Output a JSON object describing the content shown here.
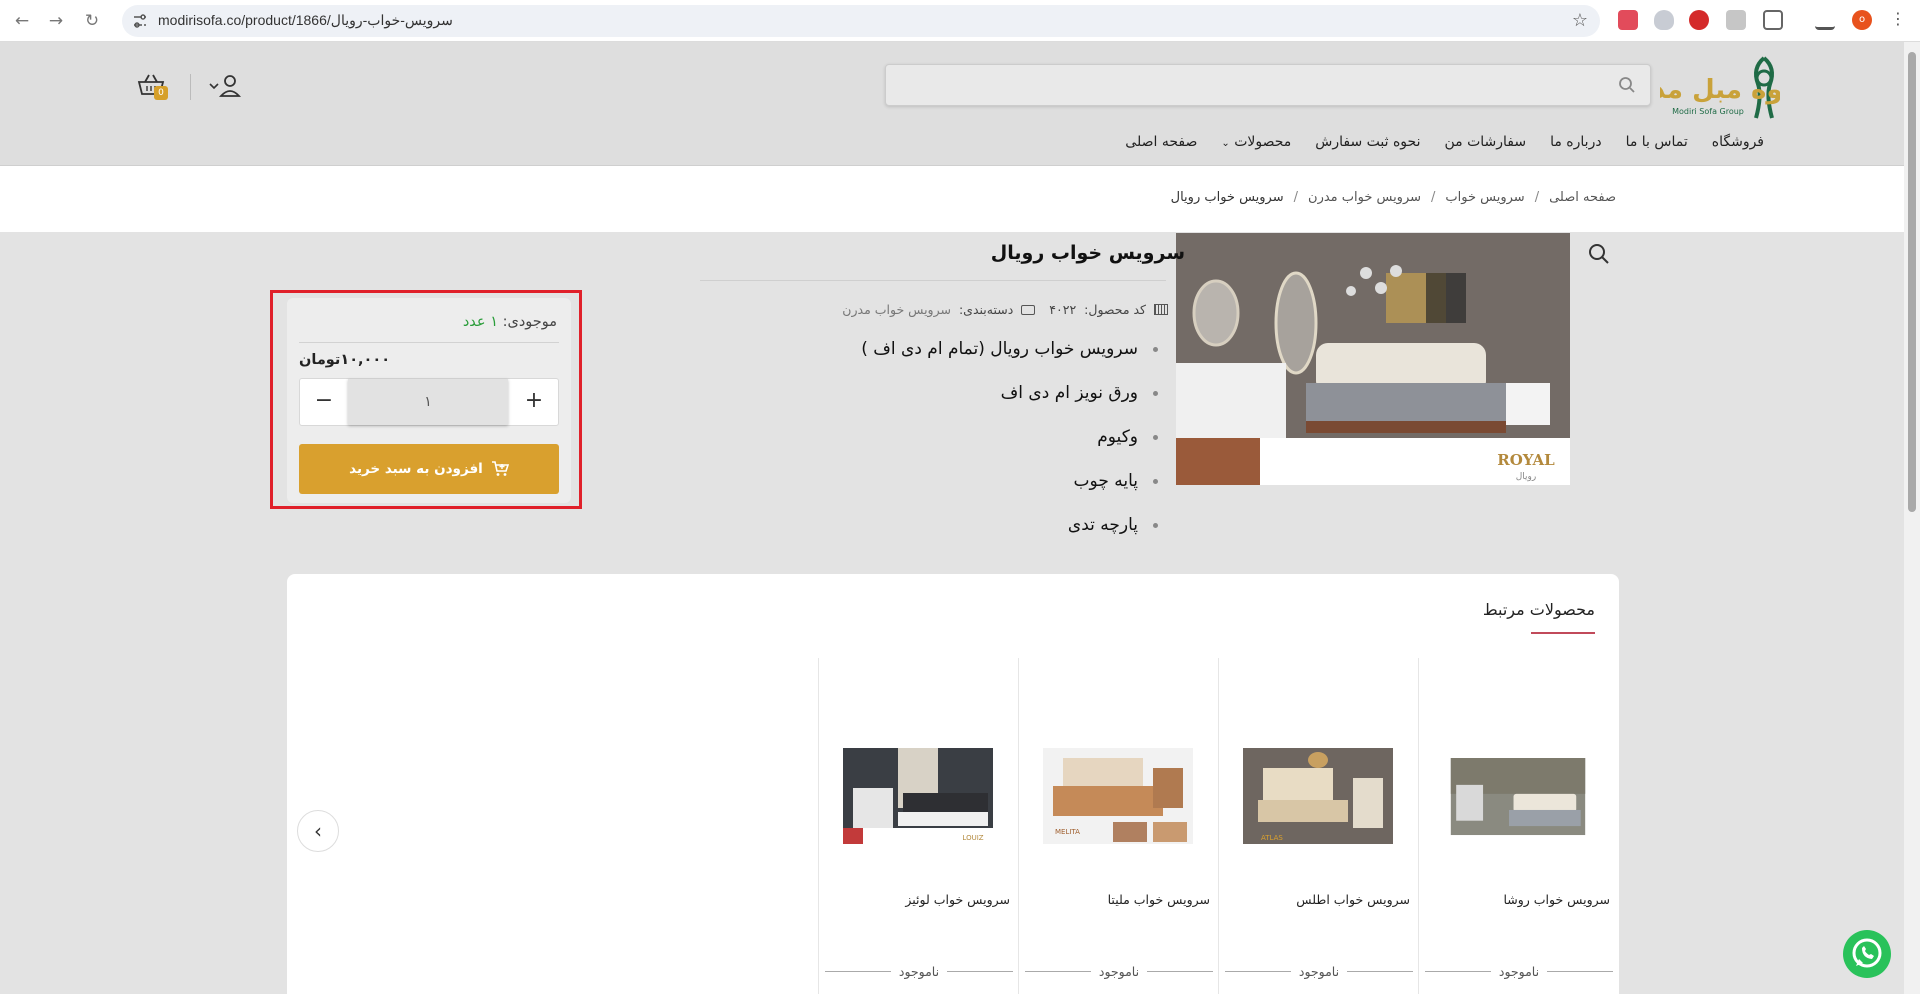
{
  "browser": {
    "url": "modirisofa.co/product/1866/سرویس-خواب-رویال",
    "profile_initial": "o"
  },
  "header": {
    "logo_text_fa": "گروه مبل مدیری",
    "logo_text_en": "Modiri Sofa Group",
    "search_placeholder": "",
    "cart_count": "0",
    "nav": [
      "صفحه اصلی",
      "محصولات",
      "نحوه ثبت سفارش",
      "سفارشات من",
      "درباره ما",
      "تماس با ما",
      "فروشگاه"
    ]
  },
  "breadcrumb": {
    "items": [
      "صفحه اصلی",
      "سرویس خواب",
      "سرویس خواب مدرن",
      "سرویس خواب رویال"
    ],
    "separator": "/"
  },
  "product": {
    "title": "سرویس خواب رویال",
    "code_label": "کد محصول:",
    "code": "۴۰۲۲",
    "category_label": "دسته‌بندی:",
    "category": "سرویس خواب مدرن",
    "features": [
      "سرویس خواب رویال (تمام ام دی اف )",
      "ورق نویز ام دی اف",
      "وکیوم",
      "پایه چوب",
      "پارچه تدی"
    ],
    "image_brand": "ROYAL",
    "image_brand_fa": "رویال"
  },
  "buybox": {
    "stock_label": "موجودی:",
    "stock_value": "۱ عدد",
    "price": "۱۰,۰۰۰تومان",
    "quantity": "۱",
    "plus": "+",
    "minus": "−",
    "add_to_cart": "افزودن به سبد خرید"
  },
  "related": {
    "title": "محصولات مرتبط",
    "items": [
      {
        "name": "سرویس خواب روشا",
        "status": "ناموجود"
      },
      {
        "name": "سرویس خواب اطلس",
        "status": "ناموجود",
        "brand": "ATLAS"
      },
      {
        "name": "سرویس خواب ملیتا",
        "status": "ناموجود",
        "brand": "MELITA"
      },
      {
        "name": "سرویس خواب لوئیز",
        "status": "ناموجود",
        "brand": "LOUIZ"
      }
    ]
  },
  "colors": {
    "accent": "#d9a02e",
    "stock_green": "#2a9d3a",
    "highlight_red": "#e0202a",
    "underline": "#c14a5a"
  }
}
